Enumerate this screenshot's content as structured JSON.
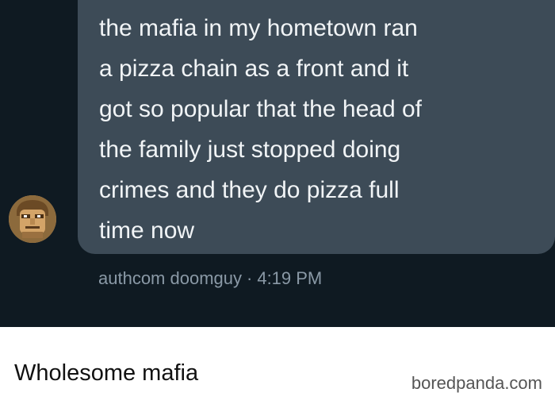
{
  "message": {
    "lines": [
      "the mafia in my hometown ran",
      "a pizza chain as a front and it",
      "got so popular that the head of",
      "the family just stopped doing",
      "crimes and they do pizza full",
      "time now"
    ],
    "author": "authcom doomguy",
    "separator": "·",
    "time": "4:19 PM",
    "avatar_icon": "doomguy-face-icon"
  },
  "caption": {
    "text": "Wholesome mafia",
    "watermark": "boredpanda.com"
  },
  "colors": {
    "chat_background": "#0f1a22",
    "bubble": "#3d4b57",
    "message_text": "#f1f4f6",
    "meta_text": "#8a99a6"
  }
}
